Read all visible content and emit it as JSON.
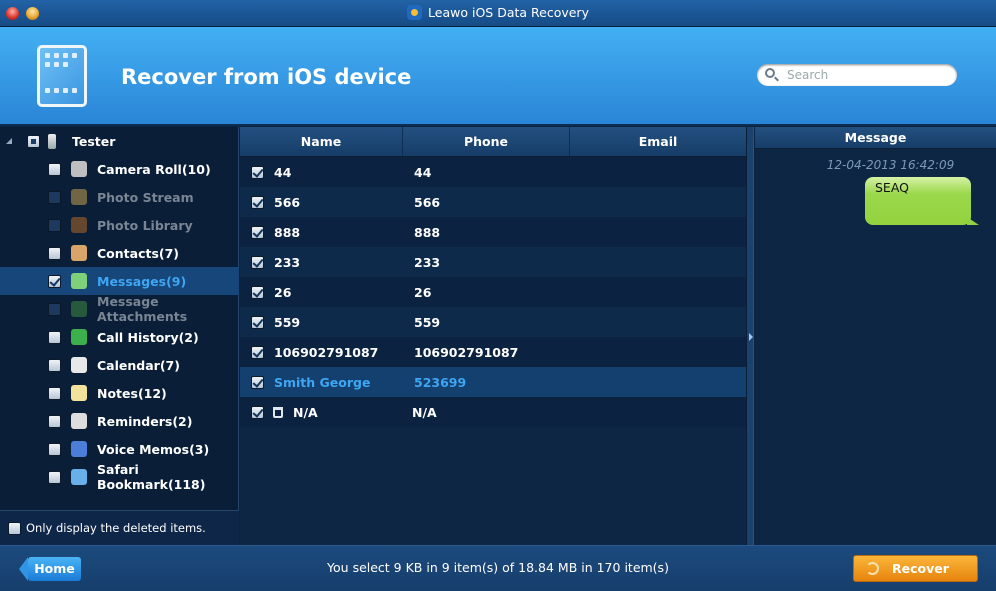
{
  "window": {
    "title": "Leawo iOS Data Recovery"
  },
  "header": {
    "title": "Recover from iOS device",
    "search_placeholder": "Search"
  },
  "sidebar": {
    "device": "Tester",
    "items": [
      {
        "label": "Camera Roll(10)",
        "enabled": true,
        "checked": false,
        "icon": "camera-icon",
        "color": "#bfbfbf"
      },
      {
        "label": "Photo Stream",
        "enabled": false,
        "checked": false,
        "icon": "sunflower-icon",
        "color": "#c4a050"
      },
      {
        "label": "Photo Library",
        "enabled": false,
        "checked": false,
        "icon": "photo-icon",
        "color": "#b06a28"
      },
      {
        "label": "Contacts(7)",
        "enabled": true,
        "checked": false,
        "icon": "contacts-icon",
        "color": "#d9a468"
      },
      {
        "label": "Messages(9)",
        "enabled": true,
        "checked": true,
        "selected": true,
        "icon": "messages-icon",
        "color": "#7ed07a"
      },
      {
        "label": "Message Attachments",
        "enabled": false,
        "checked": false,
        "icon": "attachment-icon",
        "color": "#3f8a40"
      },
      {
        "label": "Call History(2)",
        "enabled": true,
        "checked": false,
        "icon": "phone-icon",
        "color": "#3cb04a"
      },
      {
        "label": "Calendar(7)",
        "enabled": true,
        "checked": false,
        "icon": "calendar-icon",
        "color": "#e8e8e8"
      },
      {
        "label": "Notes(12)",
        "enabled": true,
        "checked": false,
        "icon": "notes-icon",
        "color": "#f2e29a"
      },
      {
        "label": "Reminders(2)",
        "enabled": true,
        "checked": false,
        "icon": "reminders-icon",
        "color": "#dddddd"
      },
      {
        "label": "Voice Memos(3)",
        "enabled": true,
        "checked": false,
        "icon": "voice-memo-icon",
        "color": "#4a7ed8"
      },
      {
        "label": "Safari Bookmark(118)",
        "enabled": true,
        "checked": false,
        "icon": "safari-icon",
        "color": "#6ab0e8"
      }
    ],
    "deleted_only_label": "Only display the deleted items."
  },
  "table": {
    "columns": [
      "Name",
      "Phone",
      "Email"
    ],
    "rows": [
      {
        "name": "44",
        "phone": "44",
        "email": ""
      },
      {
        "name": "566",
        "phone": "566",
        "email": ""
      },
      {
        "name": "888",
        "phone": "888",
        "email": ""
      },
      {
        "name": "233",
        "phone": "233",
        "email": ""
      },
      {
        "name": "26",
        "phone": "26",
        "email": ""
      },
      {
        "name": "559",
        "phone": "559",
        "email": ""
      },
      {
        "name": "106902791087",
        "phone": "106902791087",
        "email": ""
      },
      {
        "name": "Smith George",
        "phone": "523699",
        "email": "",
        "selected": true
      },
      {
        "name": "N/A",
        "phone": "N/A",
        "email": "",
        "deleted": true
      }
    ]
  },
  "message": {
    "header": "Message",
    "timestamp": "12-04-2013 16:42:09",
    "text": "SEAQ"
  },
  "footer": {
    "home_label": "Home",
    "status": "You select 9 KB in 9 item(s) of 18.84 MB in 170 item(s)",
    "recover_label": "Recover"
  }
}
